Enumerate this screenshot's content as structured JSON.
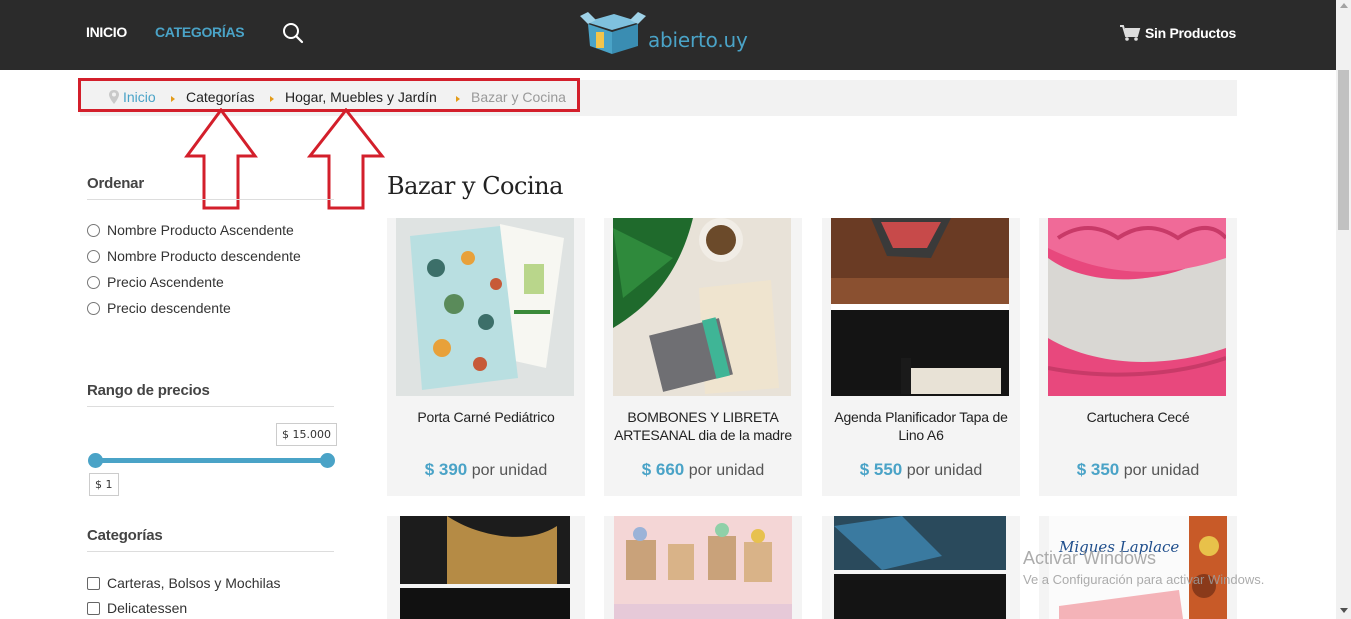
{
  "nav": {
    "home": "INICIO",
    "categories": "CATEGORÍAS",
    "logo_text": "abierto.uy",
    "cart": "Sin Productos"
  },
  "breadcrumb": {
    "home": "Inicio",
    "categories": "Categorías",
    "parent": "Hogar, Muebles y Jardín",
    "current": "Bazar y Cocina"
  },
  "sidebar": {
    "sort_title": "Ordenar",
    "sort_options": [
      "Nombre Producto Ascendente",
      "Nombre Producto descendente",
      "Precio Ascendente",
      "Precio descendente"
    ],
    "price_title": "Rango de precios",
    "price_max": "$ 15.000",
    "price_min": "$ 1",
    "categories_title": "Categorías",
    "categories": [
      "Carteras, Bolsos y Mochilas",
      "Delicatessen"
    ]
  },
  "main": {
    "title": "Bazar y Cocina",
    "price_suffix": "por unidad",
    "products": [
      {
        "name": "Porta Carné Pediátrico",
        "price": "$ 390"
      },
      {
        "name": "BOMBONES Y LIBRETA ARTESANAL dia de la madre",
        "price": "$ 660"
      },
      {
        "name": "Agenda Planificador Tapa de Lino A6",
        "price": "$ 550"
      },
      {
        "name": "Cartuchera Cecé",
        "price": "$ 350"
      }
    ],
    "row2_card4_text": "Migues Laplace"
  },
  "watermark": {
    "title": "Activar Windows",
    "sub": "Ve a Configuración para activar Windows."
  },
  "colors": {
    "accent": "#4aa3c7",
    "topbar": "#2b2b2b",
    "highlight": "#d31f2b"
  }
}
